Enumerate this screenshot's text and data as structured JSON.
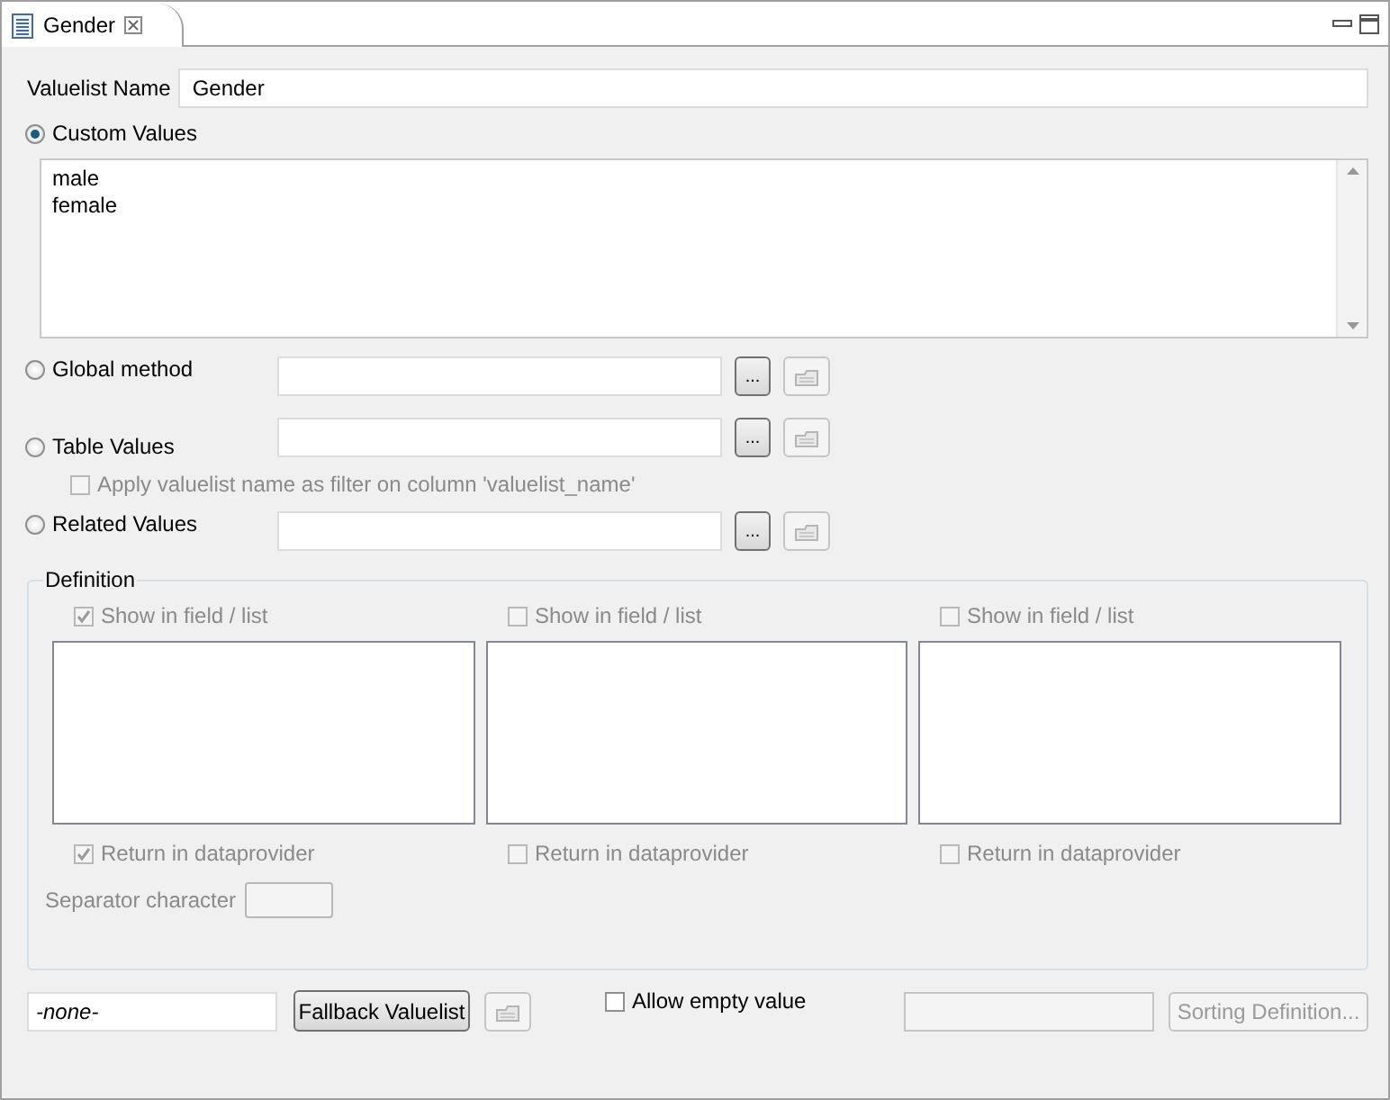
{
  "tab": {
    "title": "Gender"
  },
  "name_field": {
    "label": "Valuelist Name",
    "value": "Gender"
  },
  "custom_values": {
    "label": "Custom Values",
    "selected": true,
    "value": "male\nfemale"
  },
  "sources": [
    {
      "label": "Global method",
      "selected": false,
      "browse": "..."
    },
    {
      "label": "Table Values",
      "selected": false,
      "browse": "...",
      "filter": {
        "label": "Apply valuelist name as filter on column 'valuelist_name'",
        "checked": false,
        "disabled": true
      }
    },
    {
      "label": "Related Values",
      "selected": false,
      "browse": "..."
    }
  ],
  "definition": {
    "title": "Definition",
    "columns": [
      {
        "show": {
          "label": "Show in field / list",
          "checked": true
        },
        "return": {
          "label": "Return in dataprovider",
          "checked": true
        }
      },
      {
        "show": {
          "label": "Show in field / list",
          "checked": false
        },
        "return": {
          "label": "Return in dataprovider",
          "checked": false
        }
      },
      {
        "show": {
          "label": "Show in field / list",
          "checked": false
        },
        "return": {
          "label": "Return in dataprovider",
          "checked": false
        }
      }
    ],
    "separator_label": "Separator character",
    "disabled": true
  },
  "bottom": {
    "fallback_value": "-none-",
    "fallback_button": "Fallback Valuelist",
    "allow_empty": {
      "label": "Allow empty value",
      "checked": false
    },
    "sorting_button": "Sorting Definition...",
    "sorting_disabled": true
  }
}
